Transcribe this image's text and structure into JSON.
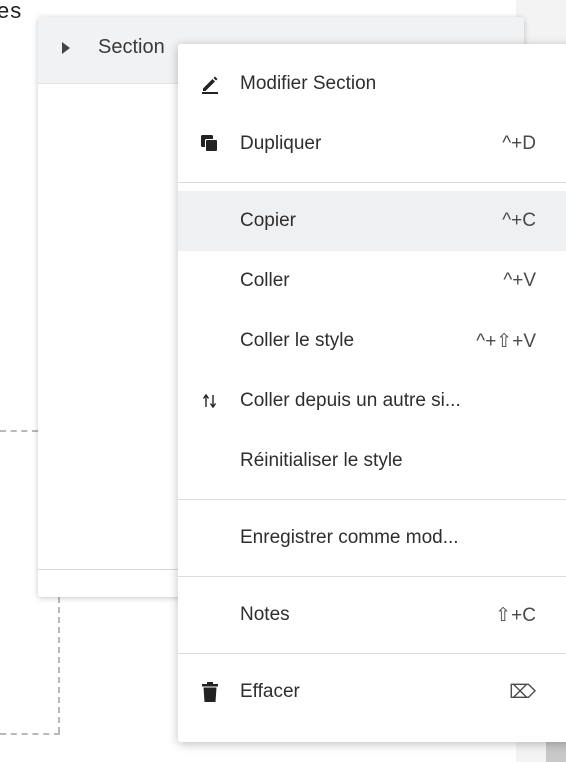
{
  "background": {
    "cut_text": "es"
  },
  "navigator": {
    "item_label": "Section"
  },
  "context_menu": {
    "items": [
      {
        "label": "Modifier Section",
        "shortcut": "",
        "icon": "pencil-icon"
      },
      {
        "label": "Dupliquer",
        "shortcut": "^+D",
        "icon": "duplicate-icon"
      },
      {
        "label": "Copier",
        "shortcut": "^+C",
        "icon": ""
      },
      {
        "label": "Coller",
        "shortcut": "^+V",
        "icon": ""
      },
      {
        "label": "Coller le style",
        "shortcut": "^+⇧+V",
        "icon": ""
      },
      {
        "label": "Coller depuis un autre si...",
        "shortcut": "",
        "icon": "arrows-updown-icon"
      },
      {
        "label": "Réinitialiser le style",
        "shortcut": "",
        "icon": ""
      },
      {
        "label": "Enregistrer comme mod...",
        "shortcut": "",
        "icon": ""
      },
      {
        "label": "Notes",
        "shortcut": "⇧+C",
        "icon": ""
      },
      {
        "label": "Effacer",
        "shortcut": "⌦",
        "icon": "trash-icon"
      }
    ]
  }
}
